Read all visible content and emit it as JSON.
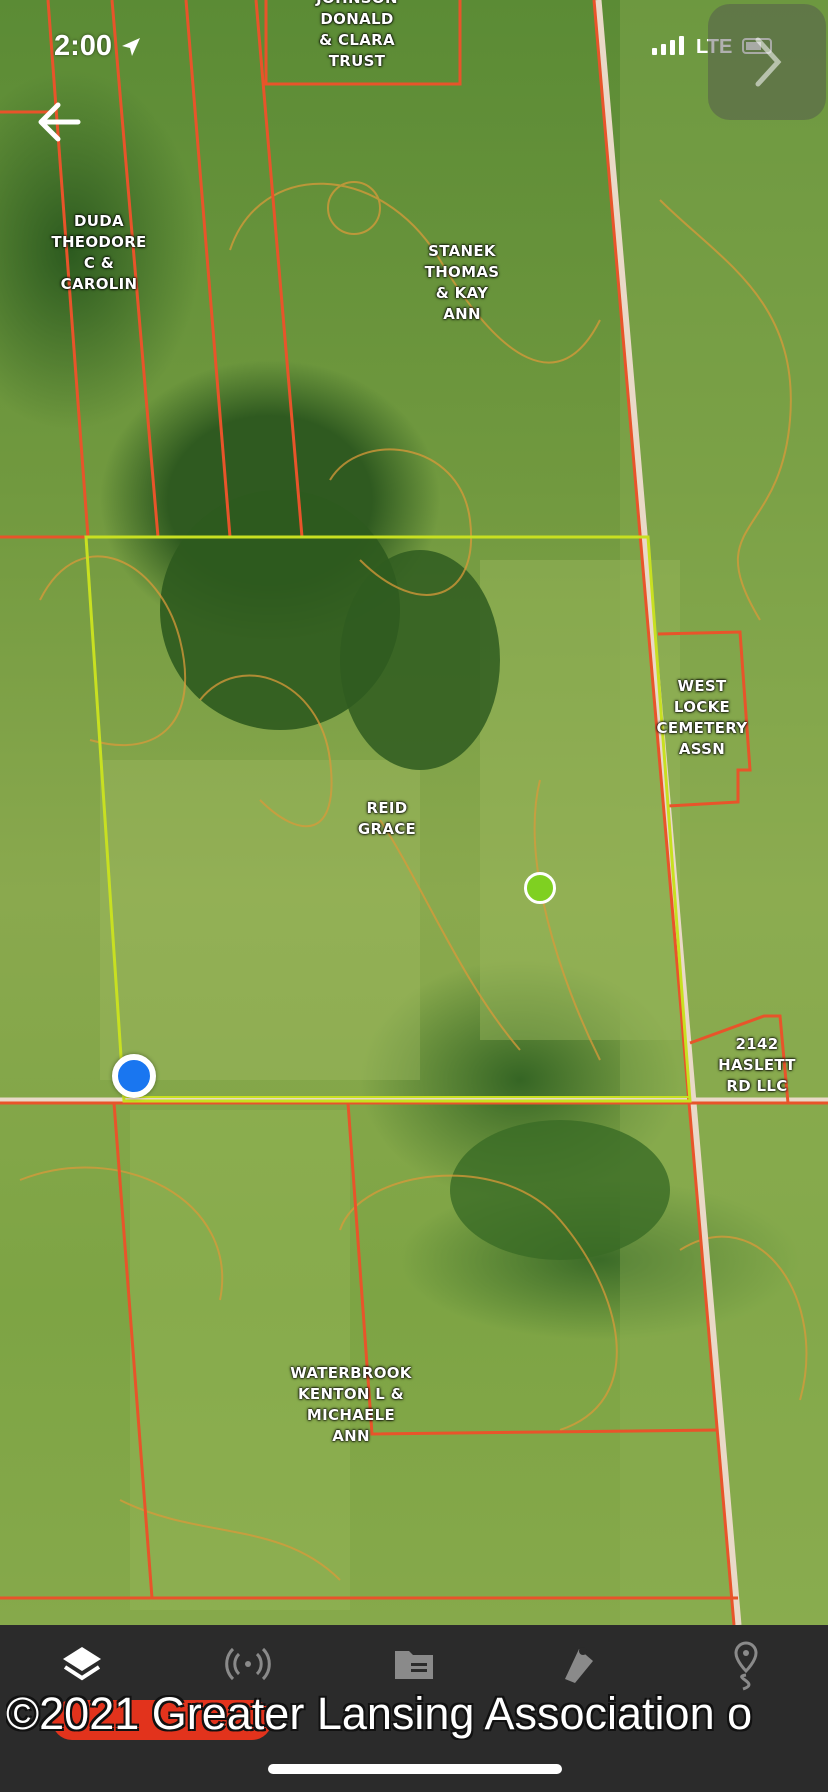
{
  "status_bar": {
    "time": "2:00",
    "network": "LTE"
  },
  "map": {
    "parcels": [
      {
        "id": "johnson",
        "lines": [
          "JOHNSON",
          "DONALD",
          "& CLARA",
          "TRUST"
        ]
      },
      {
        "id": "duda",
        "lines": [
          "DUDA",
          "THEODORE",
          "C &",
          "CAROLIN"
        ]
      },
      {
        "id": "stanek",
        "lines": [
          "STANEK",
          "THOMAS",
          "& KAY",
          "ANN"
        ]
      },
      {
        "id": "reid",
        "lines": [
          "REID",
          "GRACE"
        ]
      },
      {
        "id": "west-locke",
        "lines": [
          "WEST",
          "LOCKE",
          "CEMETERY",
          "ASSN"
        ]
      },
      {
        "id": "haslett",
        "lines": [
          "2142",
          "HASLETT",
          "RD LLC"
        ]
      },
      {
        "id": "waterbrook",
        "lines": [
          "WATERBROOK",
          "KENTON L &",
          "MICHAELE",
          "ANN"
        ]
      }
    ],
    "colors": {
      "boundary": "#e8542a",
      "selected_boundary": "#c8e021",
      "contour": "#d99a3a",
      "location_dot": "#1976f0",
      "marker_dot": "#7fd021"
    }
  },
  "tabbar": {
    "tabs": [
      {
        "icon": "layers-icon"
      },
      {
        "icon": "broadcast-icon"
      },
      {
        "icon": "folder-icon"
      },
      {
        "icon": "measure-icon"
      },
      {
        "icon": "route-pin-icon"
      }
    ]
  },
  "footer": {
    "copyright": "©2021 Greater Lansing Association o"
  }
}
